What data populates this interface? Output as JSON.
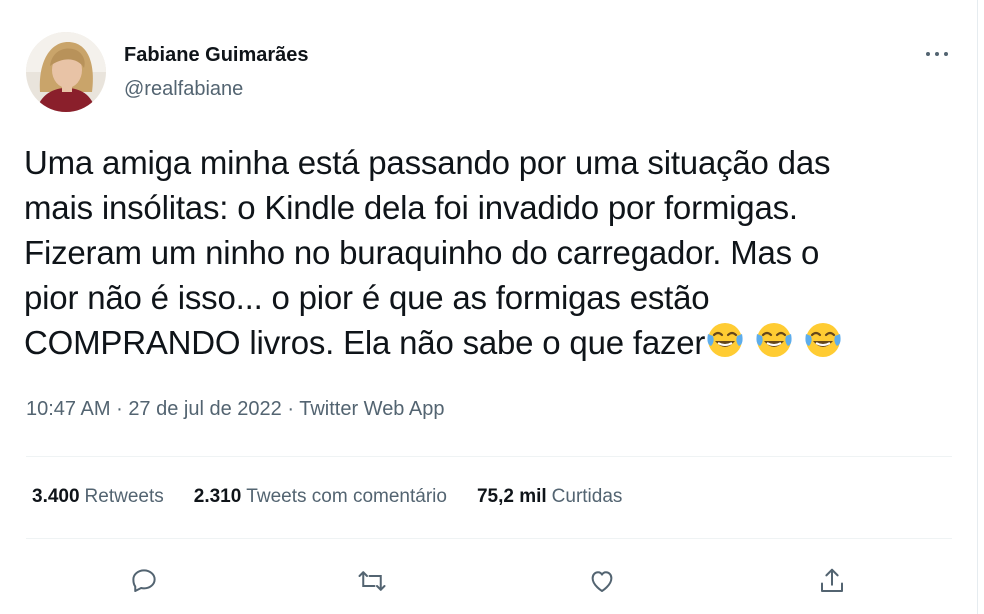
{
  "author": {
    "name": "Fabiane Guimarães",
    "handle": "@realfabiane",
    "avatar_icon": "profile-photo"
  },
  "tweet": {
    "lines": [
      "Uma amiga minha está passando por uma situação das",
      "mais insólitas: o Kindle dela foi invadido por formigas.",
      "Fizeram um ninho no buraquinho do carregador. Mas o",
      "pior não é isso... o pior é que as formigas estão",
      "COMPRANDO livros. Ela não sabe o que fazer"
    ],
    "emoji": [
      "face-with-tears-of-joy",
      "face-with-tears-of-joy",
      "face-with-tears-of-joy"
    ]
  },
  "meta": {
    "time": "10:47 AM",
    "date": "27 de jul de 2022",
    "separator": "·",
    "source": "Twitter Web App"
  },
  "stats": [
    {
      "count": "3.400",
      "label": "Retweets"
    },
    {
      "count": "2.310",
      "label": "Tweets com comentário"
    },
    {
      "count": "75,2 mil",
      "label": "Curtidas"
    }
  ],
  "actions": [
    "reply-icon",
    "retweet-icon",
    "like-icon",
    "share-icon"
  ],
  "colors": {
    "text": "#0f1419",
    "secondary": "#536471",
    "divider": "#eff3f4",
    "emoji_yellow": "#ffcc33"
  }
}
